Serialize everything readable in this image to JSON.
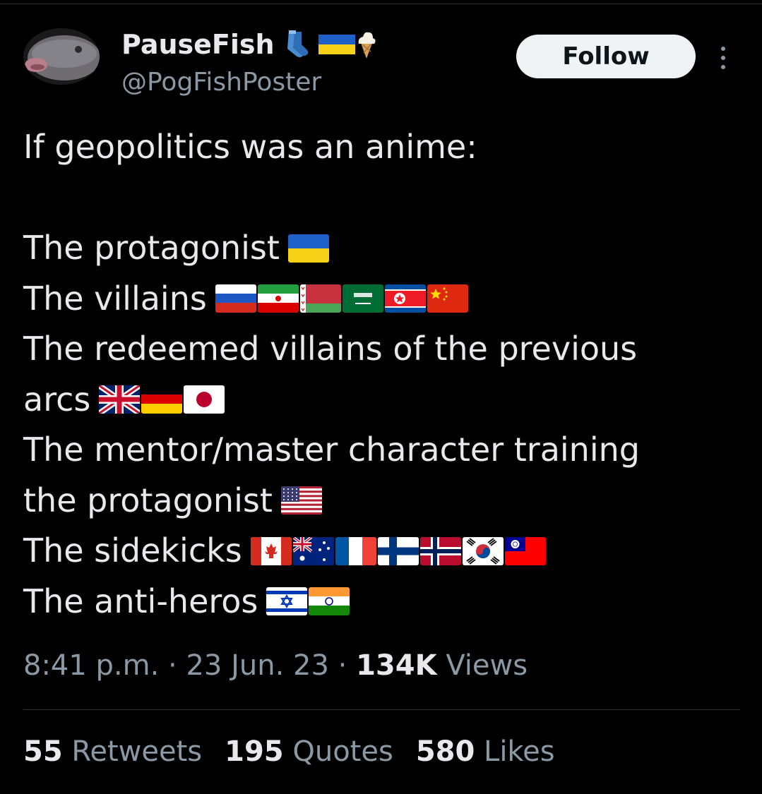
{
  "author": {
    "display_name": "PauseFish",
    "handle": "@PogFishPoster",
    "name_emojis": [
      "socks",
      "flag-ukraine",
      "soft-ice-cream"
    ]
  },
  "follow_label": "Follow",
  "tweet": {
    "lines": [
      {
        "text": "If geopolitics was an anime:",
        "flags": []
      },
      {
        "text": "",
        "flags": []
      },
      {
        "text": "The protagonist",
        "flags": [
          "UA"
        ]
      },
      {
        "text": "The villains",
        "flags": [
          "RU",
          "IR",
          "BY",
          "SA",
          "KP",
          "CN"
        ]
      },
      {
        "text": "The redeemed villains of the previous",
        "flags": []
      },
      {
        "text": "arcs",
        "flags": [
          "GB",
          "DE",
          "JP"
        ]
      },
      {
        "text": "The mentor/master character training",
        "flags": []
      },
      {
        "text": "the protagonist",
        "flags": [
          "US"
        ]
      },
      {
        "text": "The sidekicks",
        "flags": [
          "CA",
          "AU",
          "FR",
          "FI",
          "NO",
          "KR",
          "TW"
        ]
      },
      {
        "text": "The anti-heros",
        "flags": [
          "IL",
          "IN"
        ]
      }
    ]
  },
  "meta": {
    "time": "8:41 p.m.",
    "separator": "·",
    "date": "23 Jun. 23",
    "views_count": "134K",
    "views_label": "Views"
  },
  "stats": {
    "retweets_count": "55",
    "retweets_label": "Retweets",
    "quotes_count": "195",
    "quotes_label": "Quotes",
    "likes_count": "580",
    "likes_label": "Likes"
  },
  "colors": {
    "background": "#000000",
    "text_primary": "#e7e9ea",
    "text_secondary": "#8b98a5",
    "follow_bg": "#eff3f4",
    "divider": "#2f3336"
  }
}
